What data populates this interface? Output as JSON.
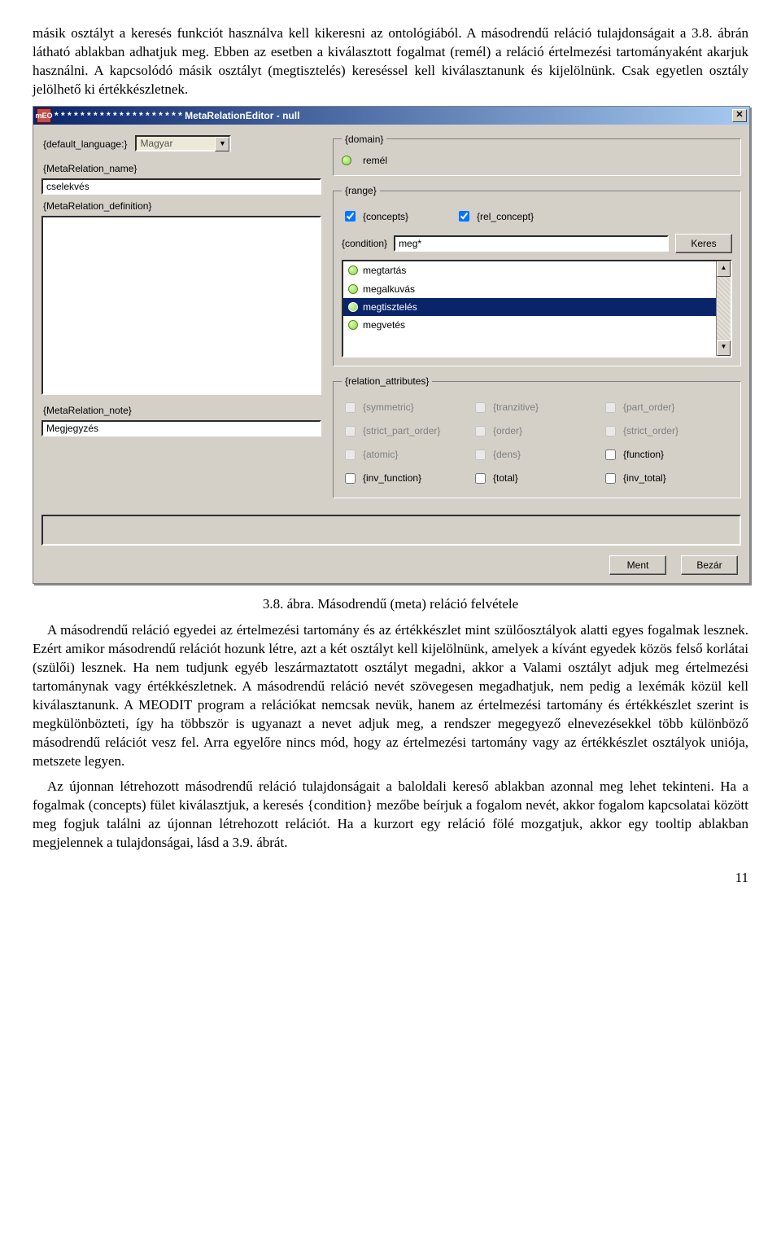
{
  "para1": "másik osztályt a keresés funkciót használva kell kikeresni az ontológiából. A másodrendű reláció tulajdonságait a 3.8. ábrán látható ablakban adhatjuk meg. Ebben az esetben a kiválasztott fogalmat (remél) a reláció értelmezési tartományaként akarjuk használni. A kapcsolódó másik osztályt (megtisztelés) kereséssel kell kiválasztanunk és kijelölnünk. Csak egyetlen osztály jelölhető ki értékkészletnek.",
  "caption": "3.8. ábra. Másodrendű (meta) reláció felvétele",
  "para2": "A másodrendű reláció egyedei az értelmezési tartomány és az értékkészlet mint szülőosztályok alatti egyes fogalmak lesznek. Ezért amikor másodrendű relációt hozunk létre, azt a két osztályt kell kijelölnünk, amelyek a kívánt egyedek közös felső korlátai (szülői) lesznek. Ha nem tudjunk egyéb leszármaztatott osztályt megadni, akkor a Valami osztályt adjuk meg értelmezési tartománynak vagy értékkészletnek. A másodrendű reláció nevét szövegesen megadhatjuk, nem pedig a lexémák közül kell kiválasztanunk. A MEODIT program a relációkat nemcsak nevük, hanem az értelmezési tartomány és értékkészlet szerint is megkülönbözteti, így ha többször is ugyanazt a nevet adjuk meg, a rendszer megegyező elnevezésekkel több különböző másodrendű relációt vesz fel. Arra egyelőre nincs mód, hogy az értelmezési tartomány vagy az értékkészlet osztályok uniója, metszete legyen.",
  "para3": "Az újonnan létrehozott másodrendű reláció tulajdonságait a baloldali kereső ablakban azonnal meg lehet tekinteni. Ha a fogalmak (concepts) fület kiválasztjuk, a keresés {condition} mezőbe beírjuk a fogalom nevét, akkor fogalom kapcsolatai között meg fogjuk találni az újonnan létrehozott relációt. Ha a kurzort egy reláció fölé mozgatjuk, akkor egy tooltip ablakban megjelennek a tulajdonságai, lásd a 3.9. ábrát.",
  "page_num": "11",
  "win": {
    "title": "* * * * * * * * * * * * * * * * * * * * MetaRelationEditor - null",
    "icon_text": "mEO",
    "left": {
      "default_language_label": "{default_language:}",
      "default_language_value": "Magyar",
      "name_label": "{MetaRelation_name}",
      "name_value": "cselekvés",
      "def_label": "{MetaRelation_definition}",
      "def_value": "",
      "note_label": "{MetaRelation_note}",
      "note_value": "Megjegyzés"
    },
    "domain_legend": "{domain}",
    "domain_value": "remél",
    "range_legend": "{range}",
    "chk_concepts": "{concepts}",
    "chk_rel_concept": "{rel_concept}",
    "condition_label": "{condition}",
    "condition_value": "meg*",
    "search_btn": "Keres",
    "list": [
      {
        "label": "megtartás",
        "selected": false
      },
      {
        "label": "megalkuvás",
        "selected": false
      },
      {
        "label": "megtisztelés",
        "selected": true
      },
      {
        "label": "megvetés",
        "selected": false
      }
    ],
    "attr_legend": "{relation_attributes}",
    "attrs": {
      "symmetric": "{symmetric}",
      "tranzitive": "{tranzitive}",
      "part_order": "{part_order}",
      "strict_part_order": "{strict_part_order}",
      "order": "{order}",
      "strict_order": "{strict_order}",
      "atomic": "{atomic}",
      "dens": "{dens}",
      "function": "{function}",
      "inv_function": "{inv_function}",
      "total": "{total}",
      "inv_total": "{inv_total}"
    },
    "save_btn": "Ment",
    "close_btn": "Bezár"
  }
}
